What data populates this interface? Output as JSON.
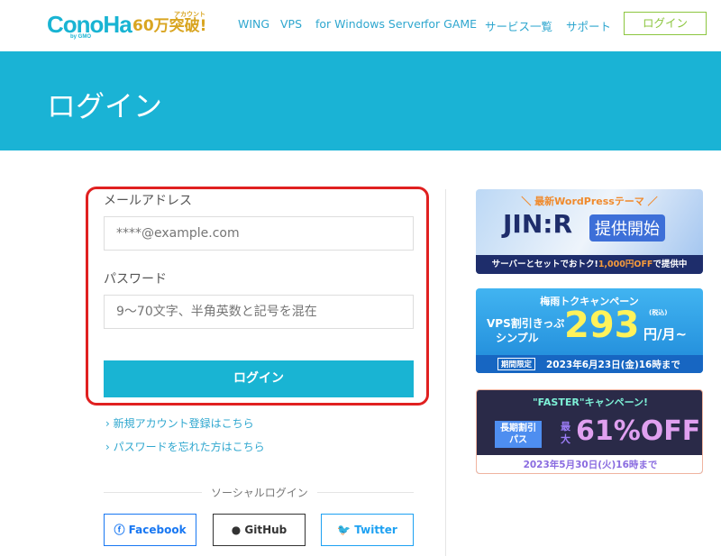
{
  "header": {
    "logo": "ConoHa",
    "logo_sub": "by GMO",
    "badge": "60万突破!",
    "badge_small": "アカウント",
    "nav": [
      "WING",
      "VPS",
      "for Windows Server",
      "for GAME",
      "サービス一覧",
      "サポート"
    ],
    "login_button": "ログイン"
  },
  "hero": {
    "title": "ログイン"
  },
  "form": {
    "email_label": "メールアドレス",
    "email_placeholder": "****@example.com",
    "password_label": "パスワード",
    "password_placeholder": "9～70文字、半角英数と記号を混在",
    "submit": "ログイン",
    "links": [
      "新規アカウント登録はこちら",
      "パスワードを忘れた方はこちら"
    ],
    "social_label": "ソーシャルログイン",
    "social": [
      "Facebook",
      "GitHub",
      "Twitter"
    ]
  },
  "ads": [
    {
      "top": "＼ 最新WordPressテーマ ／",
      "main": "JIN:R",
      "tag": "提供開始",
      "bottom": "サーバーとセットでおトク!",
      "highlight": "1,000円OFF",
      "bottom2": "で提供中"
    },
    {
      "top": "梅雨トクキャンペーン",
      "left1": "VPS割引きっぷ",
      "left2": "シンプル",
      "price": "293",
      "unit": "円/月~",
      "tax": "(税込)",
      "badge": "期間限定",
      "date": "2023年6月23日(金)16時まで"
    },
    {
      "top": "\"FASTER\"キャンペーン!",
      "left1": "長期割引",
      "left2": "パス",
      "max": "最大",
      "pct": "61%OFF",
      "date": "2023年5月30日(火)16時まで"
    }
  ],
  "colors": {
    "brand": "#19b4d3",
    "highlight": "#e02020",
    "login": "#8cc63f"
  }
}
